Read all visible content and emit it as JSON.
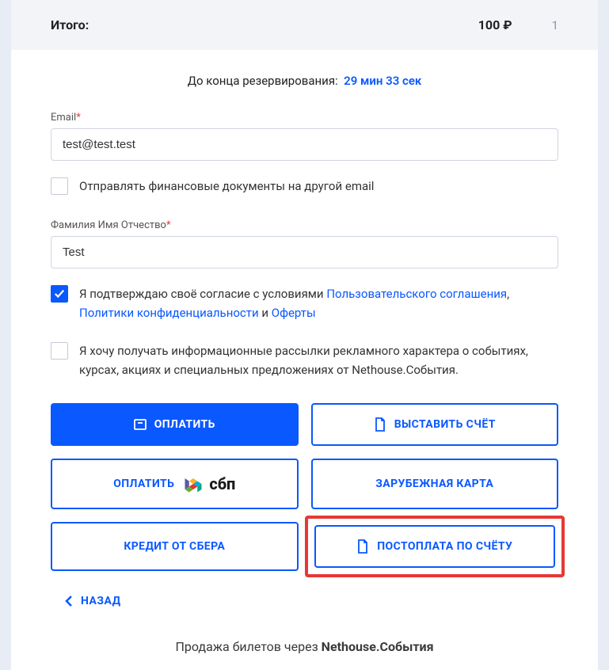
{
  "summary": {
    "label": "Итого:",
    "price": "100 ₽",
    "qty": "1"
  },
  "timer": {
    "label": "До конца резервирования:",
    "value": "29 мин 33 сек"
  },
  "fields": {
    "email": {
      "label": "Email",
      "value": "test@test.test"
    },
    "name": {
      "label": "Фамилия Имя Отчество",
      "value": "Test"
    }
  },
  "checkboxes": {
    "other_email": "Отправлять финансовые документы на другой email",
    "agreement": {
      "prefix": "Я подтверждаю своё согласие с условиями ",
      "link1": "Пользовательского соглашения",
      "sep1": ", ",
      "link2": "Политики конфиденциальности",
      "sep2": " и ",
      "link3": "Оферты"
    },
    "marketing": "Я хочу получать информационные рассылки рекламного характера о событиях, курсах, акциях и специальных предложениях от Nethouse.События."
  },
  "buttons": {
    "pay": "ОПЛАТИТЬ",
    "invoice": "ВЫСТАВИТЬ СЧЁТ",
    "pay_sbp": "ОПЛАТИТЬ",
    "sbp_text": "сбп",
    "foreign_card": "ЗАРУБЕЖНАЯ КАРТА",
    "sber_credit": "КРЕДИТ ОТ СБЕРА",
    "post_pay": "ПОСТОПЛАТА ПО СЧЁТУ",
    "back": "НАЗАД"
  },
  "footer": {
    "prefix": "Продажа билетов через ",
    "brand": "Nethouse.События"
  }
}
